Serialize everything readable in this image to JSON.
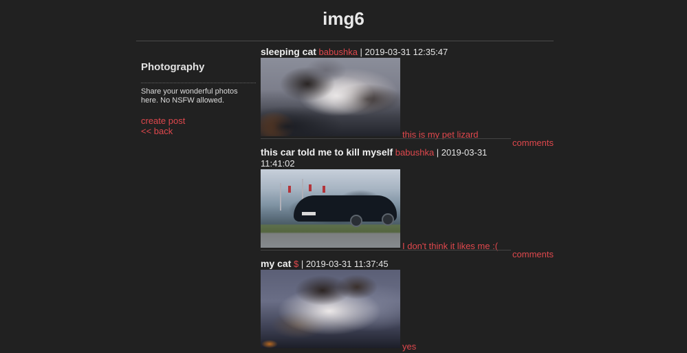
{
  "site": {
    "title": "img6"
  },
  "sidebar": {
    "board_name": "Photography",
    "description": "Share your wonderful photos here. No NSFW allowed.",
    "links": [
      {
        "label": "create post"
      },
      {
        "label": "<< back"
      }
    ]
  },
  "posts": [
    {
      "title": "sleeping cat",
      "author": "babushka",
      "meta": " | 2019-03-31 12:35:47",
      "caption": "this is my pet lizard",
      "comments_label": "comments",
      "image": "sleeping-cat-photo"
    },
    {
      "title": "this car told me to kill myself",
      "author": "babushka",
      "meta": " | 2019-03-31 11:41:02",
      "caption": "I don't think it likes me :(",
      "comments_label": "comments",
      "image": "black-car-photo"
    },
    {
      "title": "my cat",
      "author": "$",
      "meta": " | 2019-03-31 11:37:45",
      "caption": "yes",
      "image": "fluffy-cat-photo"
    }
  ],
  "colors": {
    "background": "#212121",
    "link": "#e0484d",
    "text": "#e6e6e6"
  }
}
